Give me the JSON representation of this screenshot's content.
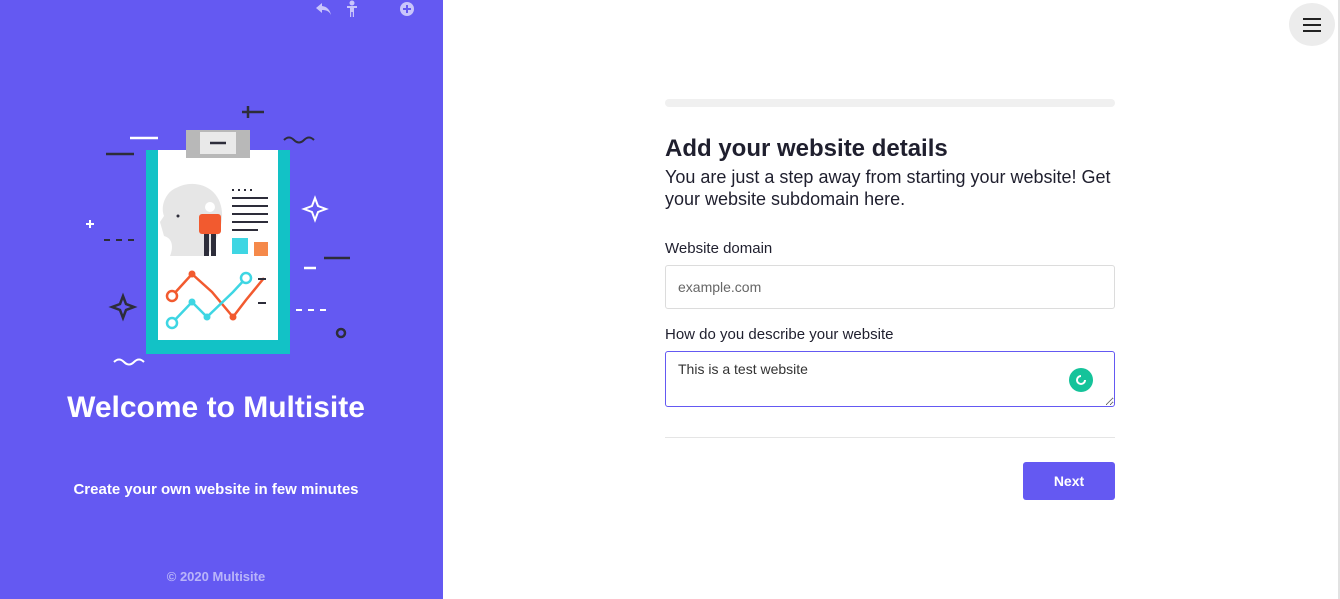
{
  "left_panel": {
    "welcome_title": "Welcome to Multisite",
    "tagline": "Create your own website in few minutes",
    "copyright": "© 2020 Multisite",
    "background_color": "#6459f2",
    "top_icons": [
      "undo-icon",
      "accessibility-person-icon",
      "add-circle-icon"
    ]
  },
  "header": {
    "menu_icon": "hamburger-menu-icon"
  },
  "form": {
    "progress": 0,
    "title": "Add your website details",
    "subtitle": "You are just a step away from starting your website! Get your website subdomain here.",
    "domain_label": "Website domain",
    "domain_placeholder": "example.com",
    "domain_value": "",
    "describe_label": "How do you describe your website",
    "describe_value": "This is a test website",
    "grammar_icon": "grammarly-icon",
    "next_label": "Next"
  },
  "colors": {
    "accent": "#6459f2",
    "grammar_green": "#15c39a"
  }
}
